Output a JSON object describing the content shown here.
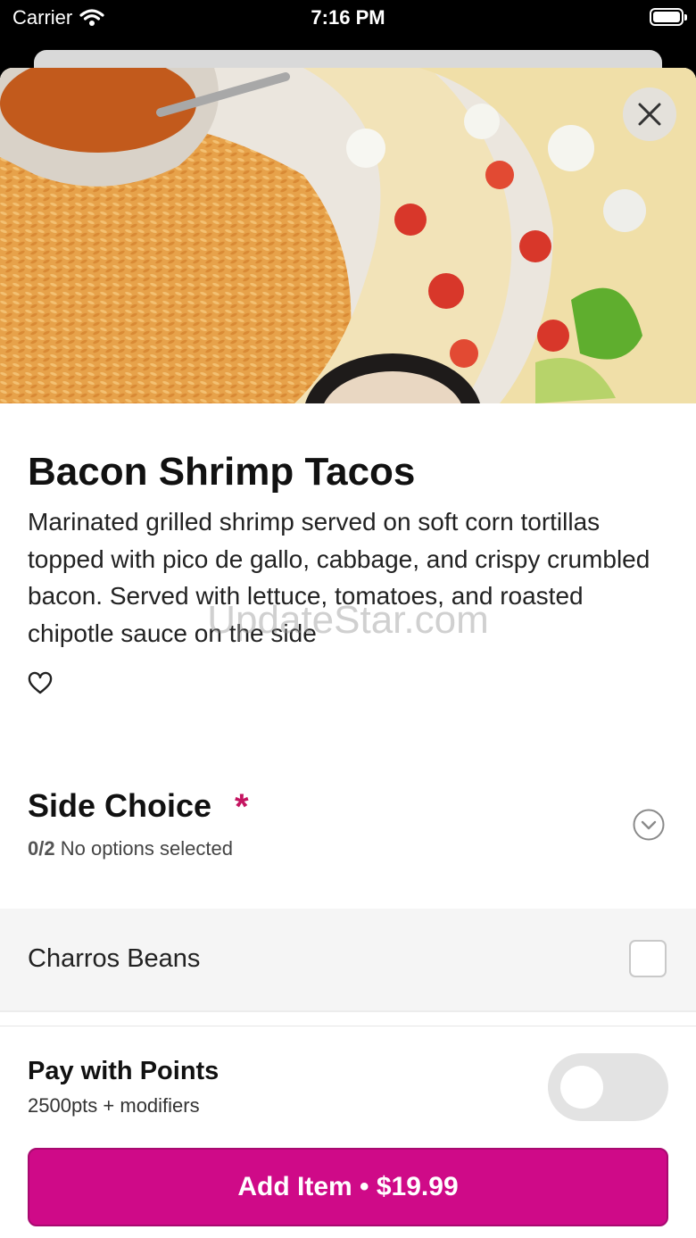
{
  "status_bar": {
    "carrier": "Carrier",
    "time": "7:16 PM"
  },
  "item": {
    "title": "Bacon Shrimp Tacos",
    "description": "Marinated grilled shrimp served on soft corn tortillas topped with pico de gallo, cabbage, and crispy crumbled bacon. Served with lettuce, tomatoes, and roasted chipotle sauce on the side",
    "image_icon": "tacos-photo"
  },
  "watermark": "UpdateStar.com",
  "side_choice": {
    "title": "Side Choice",
    "required_mark": "*",
    "count": "0/2",
    "status": "No options selected",
    "options": [
      {
        "label": "Charros Beans",
        "checked": false
      }
    ]
  },
  "points": {
    "title": "Pay with Points",
    "subtitle": "2500pts + modifiers",
    "enabled": false
  },
  "add_button": {
    "label": "Add Item • $19.99"
  },
  "colors": {
    "accent": "#cf0a88",
    "required": "#c41460"
  }
}
